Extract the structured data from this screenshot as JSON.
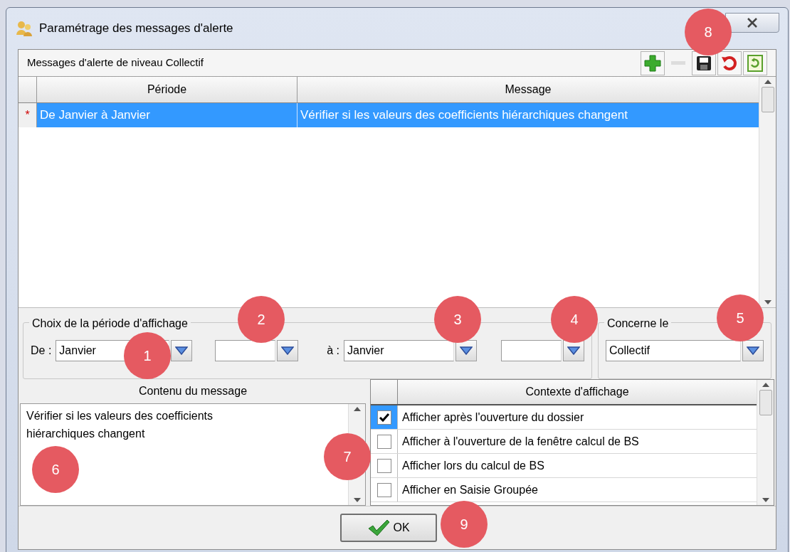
{
  "window": {
    "title": "Paramétrage des messages d'alerte"
  },
  "panel": {
    "title": "Messages d'alerte de niveau Collectif"
  },
  "toolbar": [
    {
      "kind": "add",
      "disabled": false
    },
    {
      "kind": "remove",
      "disabled": true
    },
    {
      "kind": "save",
      "disabled": false
    },
    {
      "kind": "undo",
      "disabled": false
    },
    {
      "kind": "refresh",
      "disabled": false
    }
  ],
  "grid": {
    "columns": [
      "Période",
      "Message"
    ],
    "rows": [
      {
        "marker": "*",
        "period": "De Janvier à Janvier",
        "message": "Vérifier si les valeurs des coefficients hiérarchiques changent",
        "selected": true
      }
    ]
  },
  "period_group": {
    "legend": "Choix de la période d'affichage",
    "from_label": "De :",
    "from_month": "Janvier",
    "to_label": "à :",
    "to_month": "Janvier"
  },
  "concerne_group": {
    "legend": "Concerne le",
    "value": "Collectif"
  },
  "content": {
    "header": "Contenu du message",
    "text": "Vérifier si les valeurs des coefficients hiérarchiques changent"
  },
  "context": {
    "header": "Contexte d'affichage",
    "rows": [
      {
        "label": "Afficher après l'ouverture du dossier",
        "checked": true,
        "selected": true
      },
      {
        "label": "Afficher à l'ouverture de la fenêtre calcul de BS",
        "checked": false,
        "selected": false
      },
      {
        "label": "Afficher lors du calcul de BS",
        "checked": false,
        "selected": false
      },
      {
        "label": "Afficher en Saisie Groupée",
        "checked": false,
        "selected": false
      }
    ]
  },
  "ok_button": "OK",
  "callouts": [
    "1",
    "2",
    "3",
    "4",
    "5",
    "6",
    "7",
    "8",
    "9"
  ]
}
